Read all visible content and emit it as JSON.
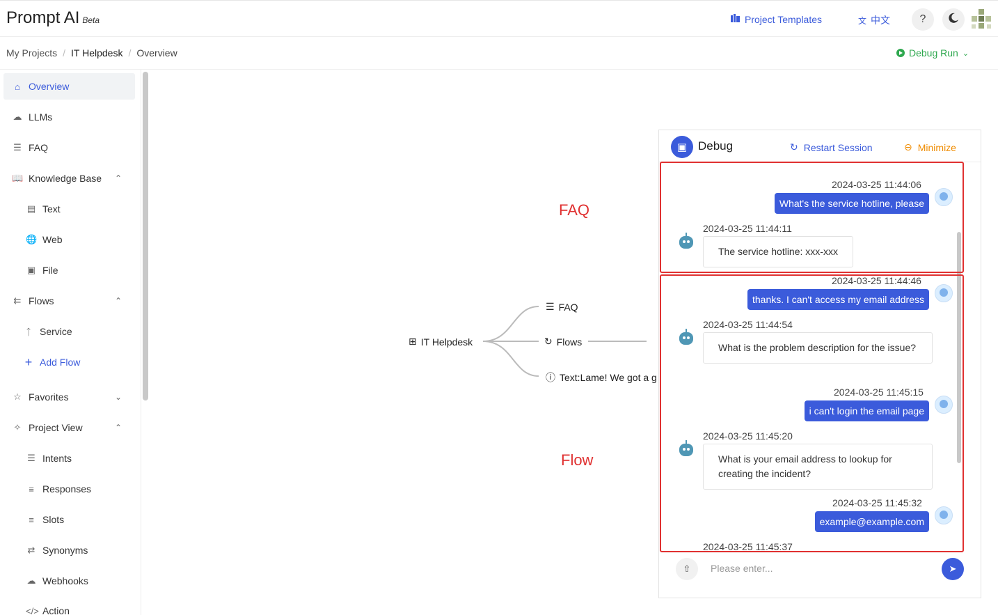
{
  "header": {
    "brand": "Prompt AI",
    "beta": "Beta",
    "templates": "Project Templates",
    "lang": "中文",
    "help": "?"
  },
  "breadcrumb": [
    "My Projects",
    "IT Helpdesk",
    "Overview"
  ],
  "debug_run": "Debug Run",
  "sidebar": {
    "overview": "Overview",
    "llms": "LLMs",
    "faq": "FAQ",
    "knowledge_base": "Knowledge Base",
    "text": "Text",
    "web": "Web",
    "file": "File",
    "flows": "Flows",
    "service": "Service",
    "add_flow": "Add Flow",
    "favorites": "Favorites",
    "project_view": "Project View",
    "intents": "Intents",
    "responses": "Responses",
    "slots": "Slots",
    "synonyms": "Synonyms",
    "webhooks": "Webhooks",
    "action": "Action"
  },
  "mindmap": {
    "root": "IT Helpdesk",
    "faq": "FAQ",
    "flows": "Flows",
    "text": "Text:Lame! We got a g"
  },
  "annotations": {
    "faq": "FAQ",
    "flow": "Flow"
  },
  "debug": {
    "title": "Debug",
    "restart": "Restart Session",
    "minimize": "Minimize",
    "placeholder": "Please enter...",
    "messages": [
      {
        "role": "user",
        "time": "2024-03-25 11:44:06",
        "text": "What's the service hotline, please"
      },
      {
        "role": "bot",
        "time": "2024-03-25 11:44:11",
        "text": "The service hotline: xxx-xxx"
      },
      {
        "role": "user",
        "time": "2024-03-25 11:44:46",
        "text": "thanks. I can't access my email address"
      },
      {
        "role": "bot",
        "time": "2024-03-25 11:44:54",
        "text": "What is the problem description for the issue?"
      },
      {
        "role": "user",
        "time": "2024-03-25 11:45:15",
        "text": "i can't login the email page"
      },
      {
        "role": "bot",
        "time": "2024-03-25 11:45:20",
        "text": "What is your email address to lookup for creating the incident?"
      },
      {
        "role": "user",
        "time": "2024-03-25 11:45:32",
        "text": "example@example.com"
      },
      {
        "role": "bot",
        "time": "2024-03-25 11:45:37",
        "text": ""
      }
    ]
  },
  "colors": {
    "accent": "#3b5bdb",
    "success": "#2fa84f",
    "warning": "#f08c00",
    "annotation": "#e03131"
  }
}
